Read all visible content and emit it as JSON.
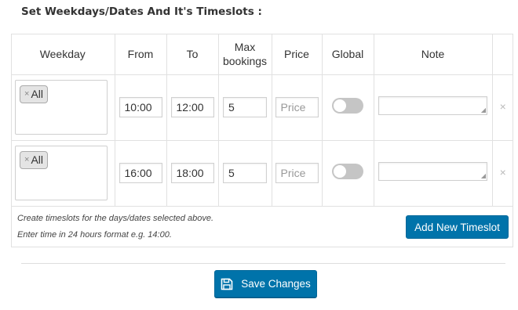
{
  "section_title": "Set Weekdays/Dates And It's Timeslots :",
  "table": {
    "headers": {
      "weekday": "Weekday",
      "from": "From",
      "to": "To",
      "max_bookings_line1": "Max",
      "max_bookings_line2": "bookings",
      "price": "Price",
      "global": "Global",
      "note": "Note"
    },
    "rows": [
      {
        "weekday_tag": "All",
        "tag_remove": "×",
        "from": "10:00",
        "to": "12:00",
        "max_bookings": "5",
        "price_placeholder": "Price",
        "global_enabled": false,
        "note": "",
        "remove": "×"
      },
      {
        "weekday_tag": "All",
        "tag_remove": "×",
        "from": "16:00",
        "to": "18:00",
        "max_bookings": "5",
        "price_placeholder": "Price",
        "global_enabled": false,
        "note": "",
        "remove": "×"
      }
    ]
  },
  "footer": {
    "note_line1": "Create timeslots for the days/dates selected above.",
    "note_line2": "Enter time in 24 hours format e.g. 14:00.",
    "add_button": "Add New Timeslot"
  },
  "save_button": "Save Changes",
  "colors": {
    "primary": "#0073aa",
    "toggle_off": "#c5c5c5",
    "border": "#e1e1e1"
  },
  "icons": {
    "save": "floppy-disk-icon",
    "remove": "close-icon",
    "resize": "resize-grip-icon"
  }
}
